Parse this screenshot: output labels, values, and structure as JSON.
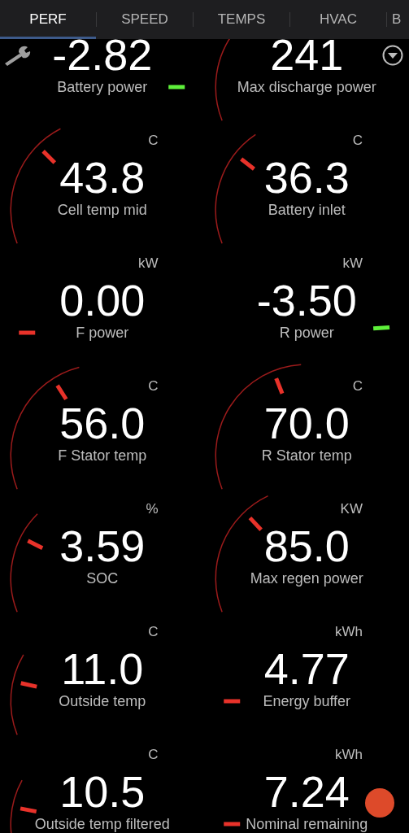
{
  "tabs": [
    {
      "label": "PERF",
      "selected": true
    },
    {
      "label": "SPEED",
      "selected": false
    },
    {
      "label": "TEMPS",
      "selected": false
    },
    {
      "label": "HVAC",
      "selected": false
    },
    {
      "label": "B",
      "selected": false
    }
  ],
  "gauges": [
    {
      "value": "-2.82",
      "label": "Battery power"
    },
    {
      "value": "241",
      "label": "Max discharge power"
    },
    {
      "unit": "C",
      "value": "43.8",
      "label": "Cell temp mid"
    },
    {
      "unit": "C",
      "value": "36.3",
      "label": "Battery inlet"
    },
    {
      "unit": "kW",
      "value": "0.00",
      "label": "F power"
    },
    {
      "unit": "kW",
      "value": "-3.50",
      "label": "R power"
    },
    {
      "unit": "C",
      "value": "56.0",
      "label": "F Stator temp"
    },
    {
      "unit": "C",
      "value": "70.0",
      "label": "R Stator temp"
    },
    {
      "unit": "%",
      "value": "3.59",
      "label": "SOC"
    },
    {
      "unit": "KW",
      "value": "85.0",
      "label": "Max regen power"
    },
    {
      "unit": "C",
      "value": "11.0",
      "label": "Outside temp"
    },
    {
      "unit": "kWh",
      "value": "4.77",
      "label": "Energy buffer"
    },
    {
      "unit": "C",
      "value": "10.5",
      "label": "Outside temp filtered"
    },
    {
      "unit": "kWh",
      "value": "7.24",
      "label": "Nominal remaining"
    }
  ]
}
